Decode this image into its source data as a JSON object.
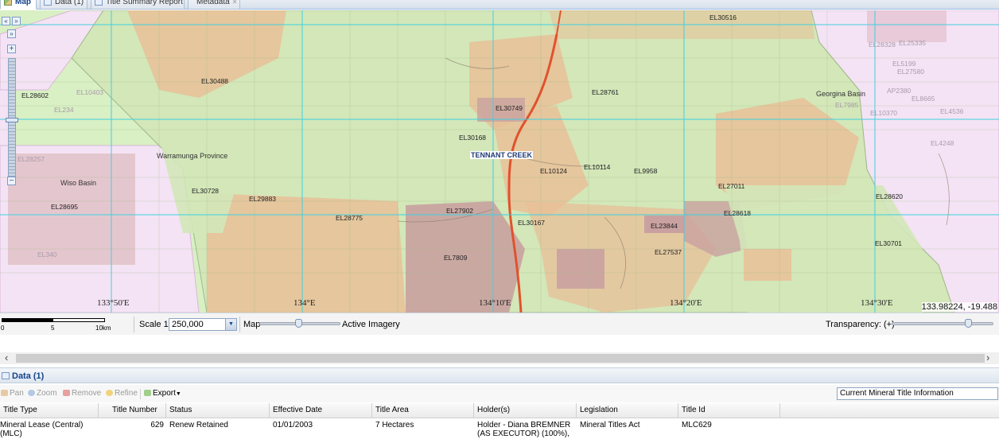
{
  "tabs": [
    {
      "label": "Map",
      "active": true,
      "icon": "map-icon"
    },
    {
      "label": "Data (1)",
      "active": false,
      "icon": "grid-icon"
    },
    {
      "label": "Title Summary Report",
      "active": false,
      "icon": "report-icon"
    },
    {
      "label": "Metadata",
      "active": false,
      "icon": "close-icon"
    }
  ],
  "map": {
    "regions": [
      "Warramunga Province",
      "Wiso Basin",
      "Georgina Basin"
    ],
    "town": "TENNANT CREEK",
    "titles": [
      "EL30516",
      "EL30488",
      "EL28602",
      "EL30749",
      "EL28761",
      "EL30168",
      "EL10124",
      "EL10114",
      "EL9958",
      "EL30728",
      "EL29883",
      "EL27011",
      "EL28620",
      "EL28695",
      "EL27902",
      "EL28775",
      "EL30167",
      "EL23844",
      "EL28618",
      "EL27537",
      "EL30701",
      "EL7809"
    ],
    "faint_titles": [
      "EL25335",
      "EL28328",
      "EL5199",
      "EL27580",
      "EL4536",
      "EL4248",
      "EL10370",
      "AP2380",
      "EL8665",
      "EL7985",
      "EL10403",
      "EL234",
      "EL28257",
      "EL340"
    ],
    "longitudes": [
      "133°50'E",
      "134°E",
      "134°10'E",
      "134°20'E",
      "134°30'E"
    ],
    "coordinates": "133.98224, -19.488",
    "colors": {
      "exploration": "#d3e7b9",
      "application": "#e9bf9a",
      "reserved": "#f3e2f3",
      "grid": "#3fd0e0",
      "highway": "#e0522c"
    }
  },
  "toolbar": {
    "scale_labels": [
      "0",
      "5",
      "10km"
    ],
    "scale_prefix": "Scale 1:",
    "scale_value": "250,000",
    "map_label": "Map",
    "imagery_label": "Active Imagery",
    "transparency_label": "Transparency: (+)"
  },
  "data_panel": {
    "title": "Data (1)",
    "tools": [
      "Pan",
      "Zoom",
      "Remove",
      "Refine",
      "Export"
    ],
    "layer_select": "Current Mineral Title Information",
    "columns": [
      "Title Type",
      "Title Number",
      "Status",
      "Effective Date",
      "Title Area",
      "Holder(s)",
      "Legislation",
      "Title Id"
    ],
    "row": {
      "title_type": "Mineral Lease (Central) (MLC)",
      "title_number": "629",
      "status": "Renew Retained",
      "effective_date": "01/01/2003",
      "title_area": "7 Hectares",
      "holders": "Holder - Diana BREMNER (AS EXECUTOR) (100%),",
      "legislation": "Mineral Titles Act",
      "title_id": "MLC629"
    }
  }
}
